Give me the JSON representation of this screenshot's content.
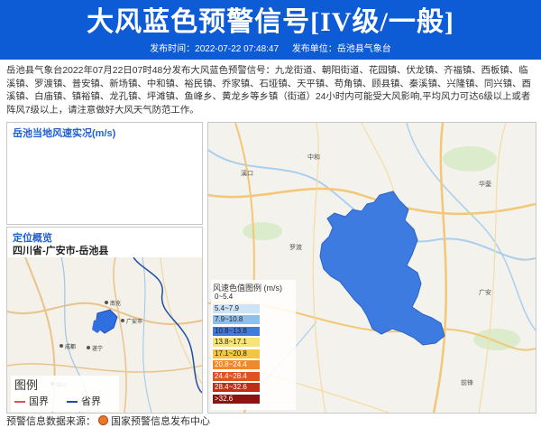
{
  "header": {
    "title": "大风蓝色预警信号[IV级/一般]",
    "publish_time": "发布时间：2022-07-22 07:48:47",
    "publisher": "发布单位：岳池县气象台"
  },
  "bulletin": {
    "text": "岳池县气象台2022年07月22日07时48分发布大风蓝色预警信号：九龙街道、朝阳街道、花园镇、伏龙镇、齐福镇、西板镇、临溪镇、罗渡镇、普安镇、新场镇、中和镇、裕民镇、乔家镇、石垭镇、天平镇、苟角镇、顾县镇、秦溪镇、兴隆镇、同兴镇、酉溪镇、白庙镇、镇裕镇、龙孔镇、坪滩镇、鱼峰乡、黄龙乡等乡镇（街道）24小时内可能受大风影响,平均风力可达6级以上或者阵风7级以上，请注意做好大风天气防范工作。"
  },
  "wind_panel": {
    "title": "岳池当地风速实况(m/s)"
  },
  "location_panel": {
    "title": "定位概览",
    "region": "四川省-广安市-岳池县",
    "legend_title": "图例",
    "legend_national": "国界",
    "legend_provincial": "省界",
    "national_color": "#d9534f",
    "provincial_color": "#1f4ea8",
    "city_labels": [
      "成都",
      "广安市",
      "南充",
      "遂宁",
      "眉山"
    ]
  },
  "main_map": {
    "warning_area_color": "#3d7be0",
    "legend_title": "风速色值图例 (m/s)",
    "legend": [
      {
        "label": "0~5.4",
        "color": "#ffffff"
      },
      {
        "label": "5.4~7.9",
        "color": "#cfe3f7"
      },
      {
        "label": "7.9~10.8",
        "color": "#8ec0ee"
      },
      {
        "label": "10.8~13.8",
        "color": "#3d7be0"
      },
      {
        "label": "13.8~17.1",
        "color": "#f6e47a"
      },
      {
        "label": "17.1~20.8",
        "color": "#f6c443"
      },
      {
        "label": "20.8~24.4",
        "color": "#ee8a2a"
      },
      {
        "label": "24.4~28.4",
        "color": "#e0521f"
      },
      {
        "label": "28.4~32.6",
        "color": "#c22d1a"
      },
      {
        "label": ">32.6",
        "color": "#8a1510"
      }
    ]
  },
  "footer": {
    "prefix": "预警信息数据来源：",
    "source": "国家预警信息发布中心"
  }
}
